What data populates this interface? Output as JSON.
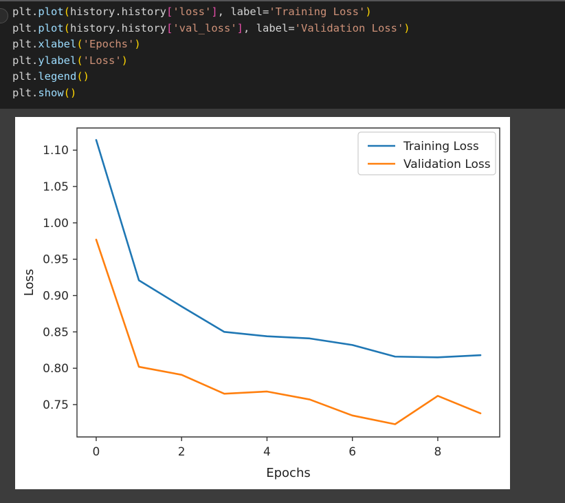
{
  "notebook": {
    "cell_background": "#1e1e1e",
    "page_background": "#3c3c3c",
    "gutter_marker": "run-cell-orb",
    "code_lines": [
      {
        "id": "line-1",
        "tokens": [
          {
            "t": "plt.",
            "c": "plain"
          },
          {
            "t": "plot",
            "c": "func"
          },
          {
            "t": "(",
            "c": "paren"
          },
          {
            "t": "history.history",
            "c": "plain"
          },
          {
            "t": "[",
            "c": "brack"
          },
          {
            "t": "'loss'",
            "c": "str"
          },
          {
            "t": "]",
            "c": "brack"
          },
          {
            "t": ", label=",
            "c": "plain"
          },
          {
            "t": "'Training Loss'",
            "c": "str"
          },
          {
            "t": ")",
            "c": "paren"
          }
        ]
      },
      {
        "id": "line-2",
        "tokens": [
          {
            "t": "plt.",
            "c": "plain"
          },
          {
            "t": "plot",
            "c": "func"
          },
          {
            "t": "(",
            "c": "paren"
          },
          {
            "t": "history.history",
            "c": "plain"
          },
          {
            "t": "[",
            "c": "brack"
          },
          {
            "t": "'val_loss'",
            "c": "str"
          },
          {
            "t": "]",
            "c": "brack"
          },
          {
            "t": ", label=",
            "c": "plain"
          },
          {
            "t": "'Validation Loss'",
            "c": "str"
          },
          {
            "t": ")",
            "c": "paren"
          }
        ]
      },
      {
        "id": "line-3",
        "tokens": [
          {
            "t": "plt.",
            "c": "plain"
          },
          {
            "t": "xlabel",
            "c": "func"
          },
          {
            "t": "(",
            "c": "paren"
          },
          {
            "t": "'Epochs'",
            "c": "str"
          },
          {
            "t": ")",
            "c": "paren"
          }
        ]
      },
      {
        "id": "line-4",
        "tokens": [
          {
            "t": "plt.",
            "c": "plain"
          },
          {
            "t": "ylabel",
            "c": "func"
          },
          {
            "t": "(",
            "c": "paren"
          },
          {
            "t": "'Loss'",
            "c": "str"
          },
          {
            "t": ")",
            "c": "paren"
          }
        ]
      },
      {
        "id": "line-5",
        "tokens": [
          {
            "t": "plt.",
            "c": "plain"
          },
          {
            "t": "legend",
            "c": "func"
          },
          {
            "t": "()",
            "c": "paren"
          }
        ]
      },
      {
        "id": "line-6",
        "tokens": [
          {
            "t": "plt.",
            "c": "plain"
          },
          {
            "t": "show",
            "c": "func"
          },
          {
            "t": "()",
            "c": "paren"
          }
        ]
      }
    ]
  },
  "chart_data": {
    "type": "line",
    "title": "",
    "xlabel": "Epochs",
    "ylabel": "Loss",
    "x": [
      0,
      1,
      2,
      3,
      4,
      5,
      6,
      7,
      8,
      9
    ],
    "series": [
      {
        "name": "Training Loss",
        "color": "#1f77b4",
        "values": [
          1.114,
          0.921,
          0.885,
          0.85,
          0.844,
          0.841,
          0.832,
          0.816,
          0.815,
          0.818
        ]
      },
      {
        "name": "Validation Loss",
        "color": "#ff7f0e",
        "values": [
          0.977,
          0.802,
          0.791,
          0.765,
          0.768,
          0.757,
          0.735,
          0.723,
          0.762,
          0.738
        ]
      }
    ],
    "xticks": [
      0,
      2,
      4,
      6,
      8
    ],
    "xtick_labels": [
      "0",
      "2",
      "4",
      "6",
      "8"
    ],
    "yticks": [
      0.75,
      0.8,
      0.85,
      0.9,
      0.95,
      1.0,
      1.05,
      1.1
    ],
    "ytick_labels": [
      "0.75",
      "0.80",
      "0.85",
      "0.90",
      "0.95",
      "1.00",
      "1.05",
      "1.10"
    ],
    "xlim": [
      -0.45,
      9.45
    ],
    "ylim": [
      0.7055,
      1.1305
    ],
    "grid": false,
    "legend_position": "upper right",
    "legend_entries": [
      "Training Loss",
      "Validation Loss"
    ]
  }
}
